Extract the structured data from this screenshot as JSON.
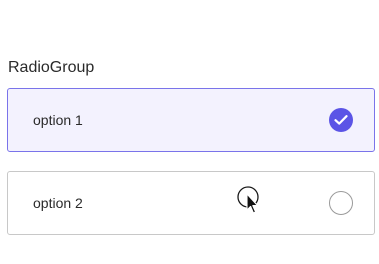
{
  "radio_group": {
    "label": "RadioGroup",
    "options": [
      {
        "label": "option 1",
        "selected": true
      },
      {
        "label": "option 2",
        "selected": false
      }
    ]
  },
  "colors": {
    "accent": "#5b54e6",
    "selected_border": "#7a73ea",
    "selected_background": "#f3f2fe",
    "unselected_border": "#c8c8c8"
  },
  "icons": {
    "check": "check-icon",
    "cursor": "mouse-pointer-icon"
  }
}
